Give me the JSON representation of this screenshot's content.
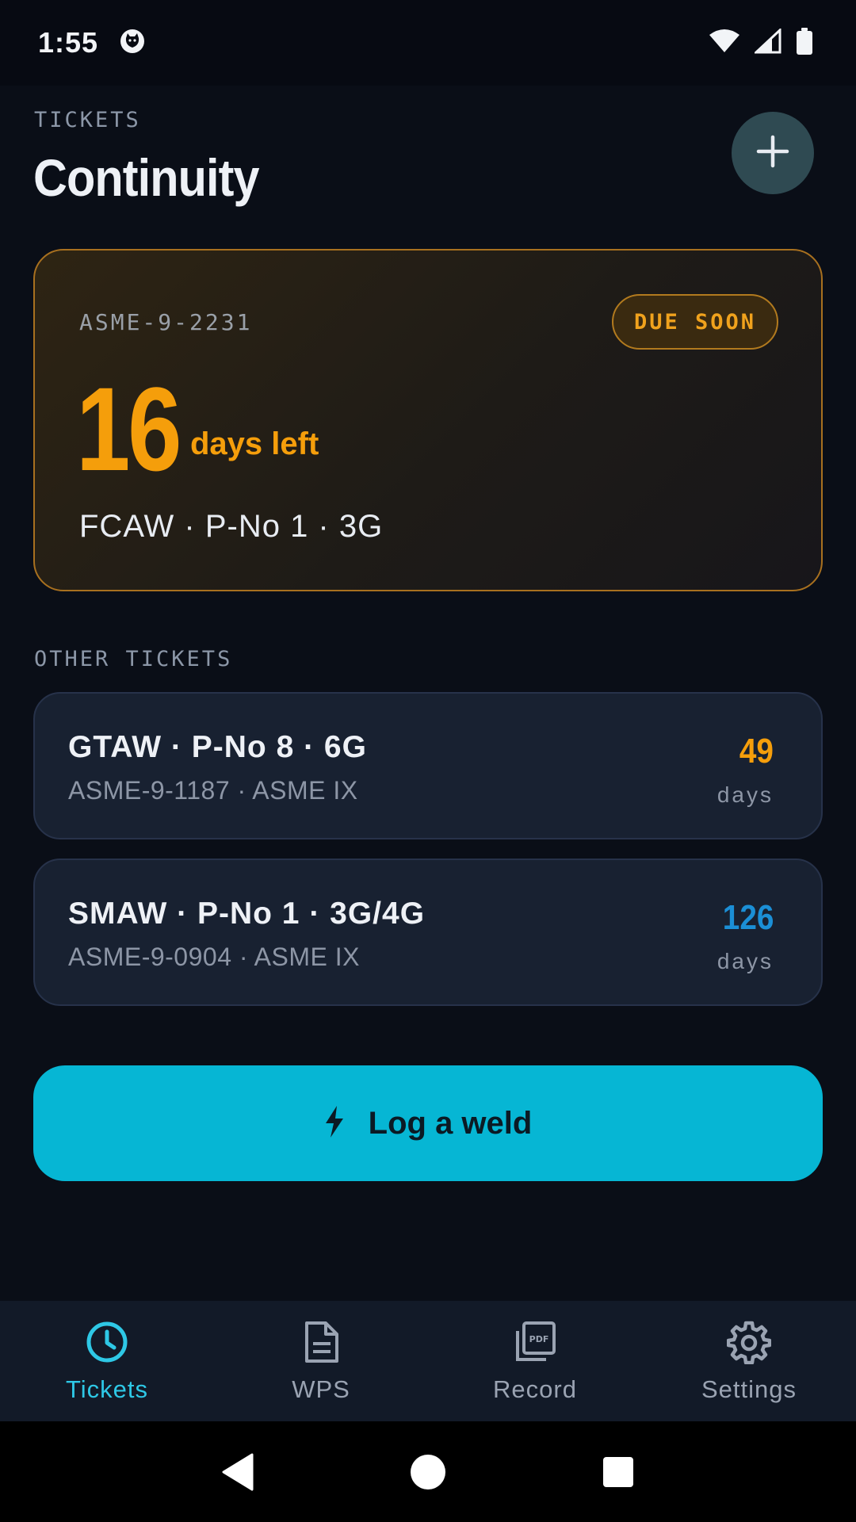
{
  "status_bar": {
    "time": "1:55"
  },
  "header": {
    "kicker": "TICKETS",
    "title": "Continuity"
  },
  "featured": {
    "id": "ASME-9-2231",
    "badge": "DUE SOON",
    "days": "16",
    "days_label": "days left",
    "spec": "FCAW · P-No 1 · 3G"
  },
  "other_section": {
    "heading": "OTHER TICKETS"
  },
  "tickets": [
    {
      "title": "GTAW · P-No 8 · 6G",
      "subtitle": "ASME-9-1187 · ASME IX",
      "days": "49",
      "unit": "days",
      "color": "#f59e0b"
    },
    {
      "title": "SMAW · P-No 1 · 3G/4G",
      "subtitle": "ASME-9-0904 · ASME IX",
      "days": "126",
      "unit": "days",
      "color": "#1b8fd6"
    }
  ],
  "actions": {
    "log_weld": "Log a weld"
  },
  "nav": [
    {
      "label": "Tickets",
      "icon": "clock-icon",
      "active": true
    },
    {
      "label": "WPS",
      "icon": "document-icon",
      "active": false
    },
    {
      "label": "Record",
      "icon": "pdf-icon",
      "active": false
    },
    {
      "label": "Settings",
      "icon": "gear-icon",
      "active": false
    }
  ],
  "colors": {
    "accent": "#06b6d4",
    "warning": "#f59e0b",
    "info": "#1b8fd6",
    "background": "#0a0e17"
  }
}
